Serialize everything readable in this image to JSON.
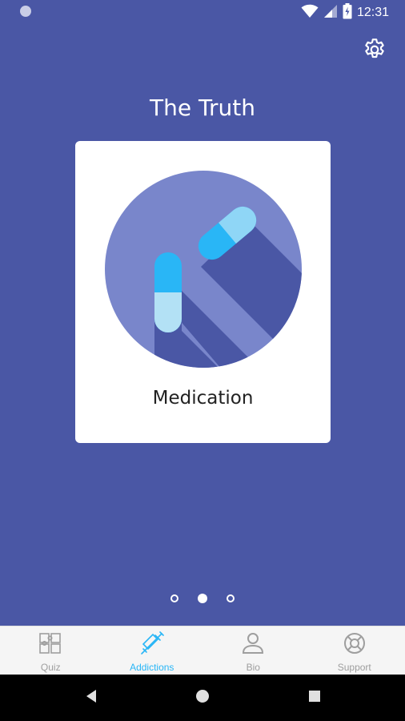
{
  "status_bar": {
    "time": "12:31",
    "icons": [
      "notification-dot-icon",
      "wifi-icon",
      "cell-signal-icon",
      "battery-charging-icon"
    ]
  },
  "header": {
    "title": "The Truth",
    "settings_icon": "gear-icon"
  },
  "carousel": {
    "current_card": {
      "label": "Medication",
      "icon": "pills-icon"
    },
    "pages": 3,
    "active_page": 2
  },
  "bottom_nav": {
    "items": [
      {
        "label": "Quiz",
        "icon": "puzzle-icon",
        "active": false
      },
      {
        "label": "Addictions",
        "icon": "syringe-icon",
        "active": true
      },
      {
        "label": "Bio",
        "icon": "person-icon",
        "active": false
      },
      {
        "label": "Support",
        "icon": "lifebuoy-icon",
        "active": false
      }
    ]
  },
  "system_nav": {
    "icons": [
      "back-icon",
      "home-icon",
      "recents-icon"
    ]
  },
  "colors": {
    "background": "#4a57a5",
    "circle": "#7986cb",
    "accent": "#29b6f6",
    "card": "#ffffff"
  }
}
